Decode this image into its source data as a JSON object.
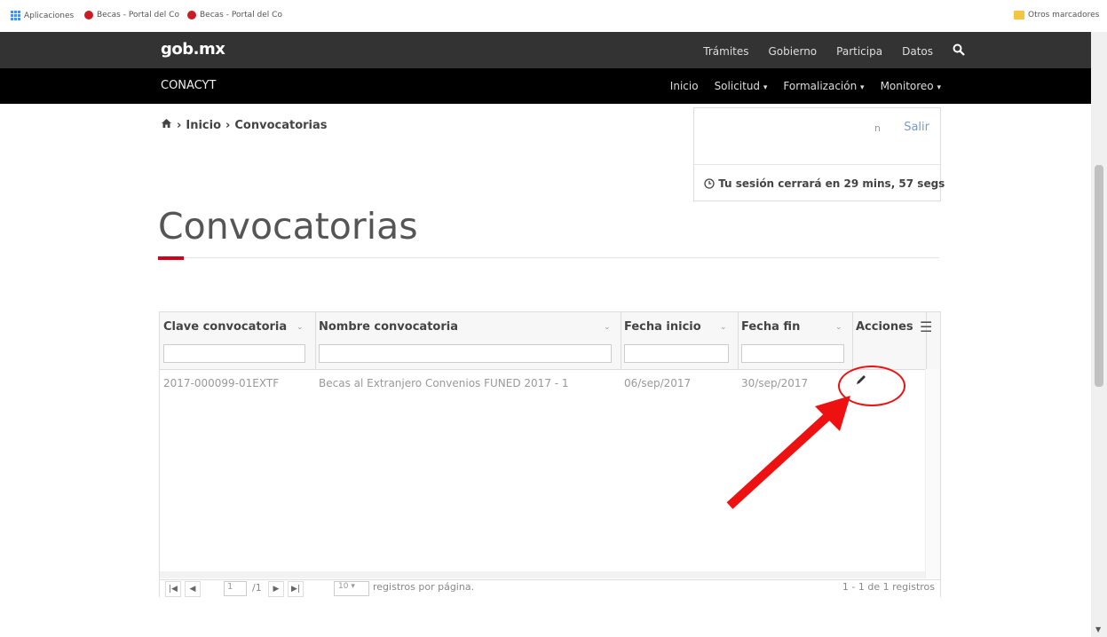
{
  "bookmarks": {
    "apps": "Aplicaciones",
    "items": [
      "Becas - Portal del Co",
      "Becas - Portal del Co"
    ],
    "other": "Otros marcadores"
  },
  "nav_primary": {
    "logo": "gob.mx",
    "links": [
      "Trámites",
      "Gobierno",
      "Participa",
      "Datos"
    ]
  },
  "nav_secondary": {
    "title": "CONACYT",
    "links": [
      "Inicio",
      "Solicitud",
      "Formalización",
      "Monitoreo"
    ]
  },
  "breadcrumb": {
    "items": [
      "Inicio",
      "Convocatorias"
    ]
  },
  "session": {
    "initial": "n",
    "logout": "Salir",
    "timer": "Tu sesión cerrará en 29 mins, 57 segs"
  },
  "page": {
    "title": "Convocatorias"
  },
  "grid": {
    "columns": [
      "Clave convocatoria",
      "Nombre convocatoria",
      "Fecha inicio",
      "Fecha fin",
      "Acciones"
    ],
    "rows": [
      {
        "clave": "2017-000099-01EXTF",
        "nombre": "Becas al Extranjero Convenios FUNED 2017 - 1",
        "inicio": "06/sep/2017",
        "fin": "30/sep/2017"
      }
    ],
    "pager": {
      "page": "1",
      "total_pages": "/1",
      "page_size": "10",
      "per_page_label": "registros por página.",
      "summary": "1 - 1 de 1 registros"
    }
  },
  "colors": {
    "accent": "#d0021b",
    "nav_primary": "#333333",
    "nav_secondary": "#000000",
    "annotation": "#ee1111"
  }
}
